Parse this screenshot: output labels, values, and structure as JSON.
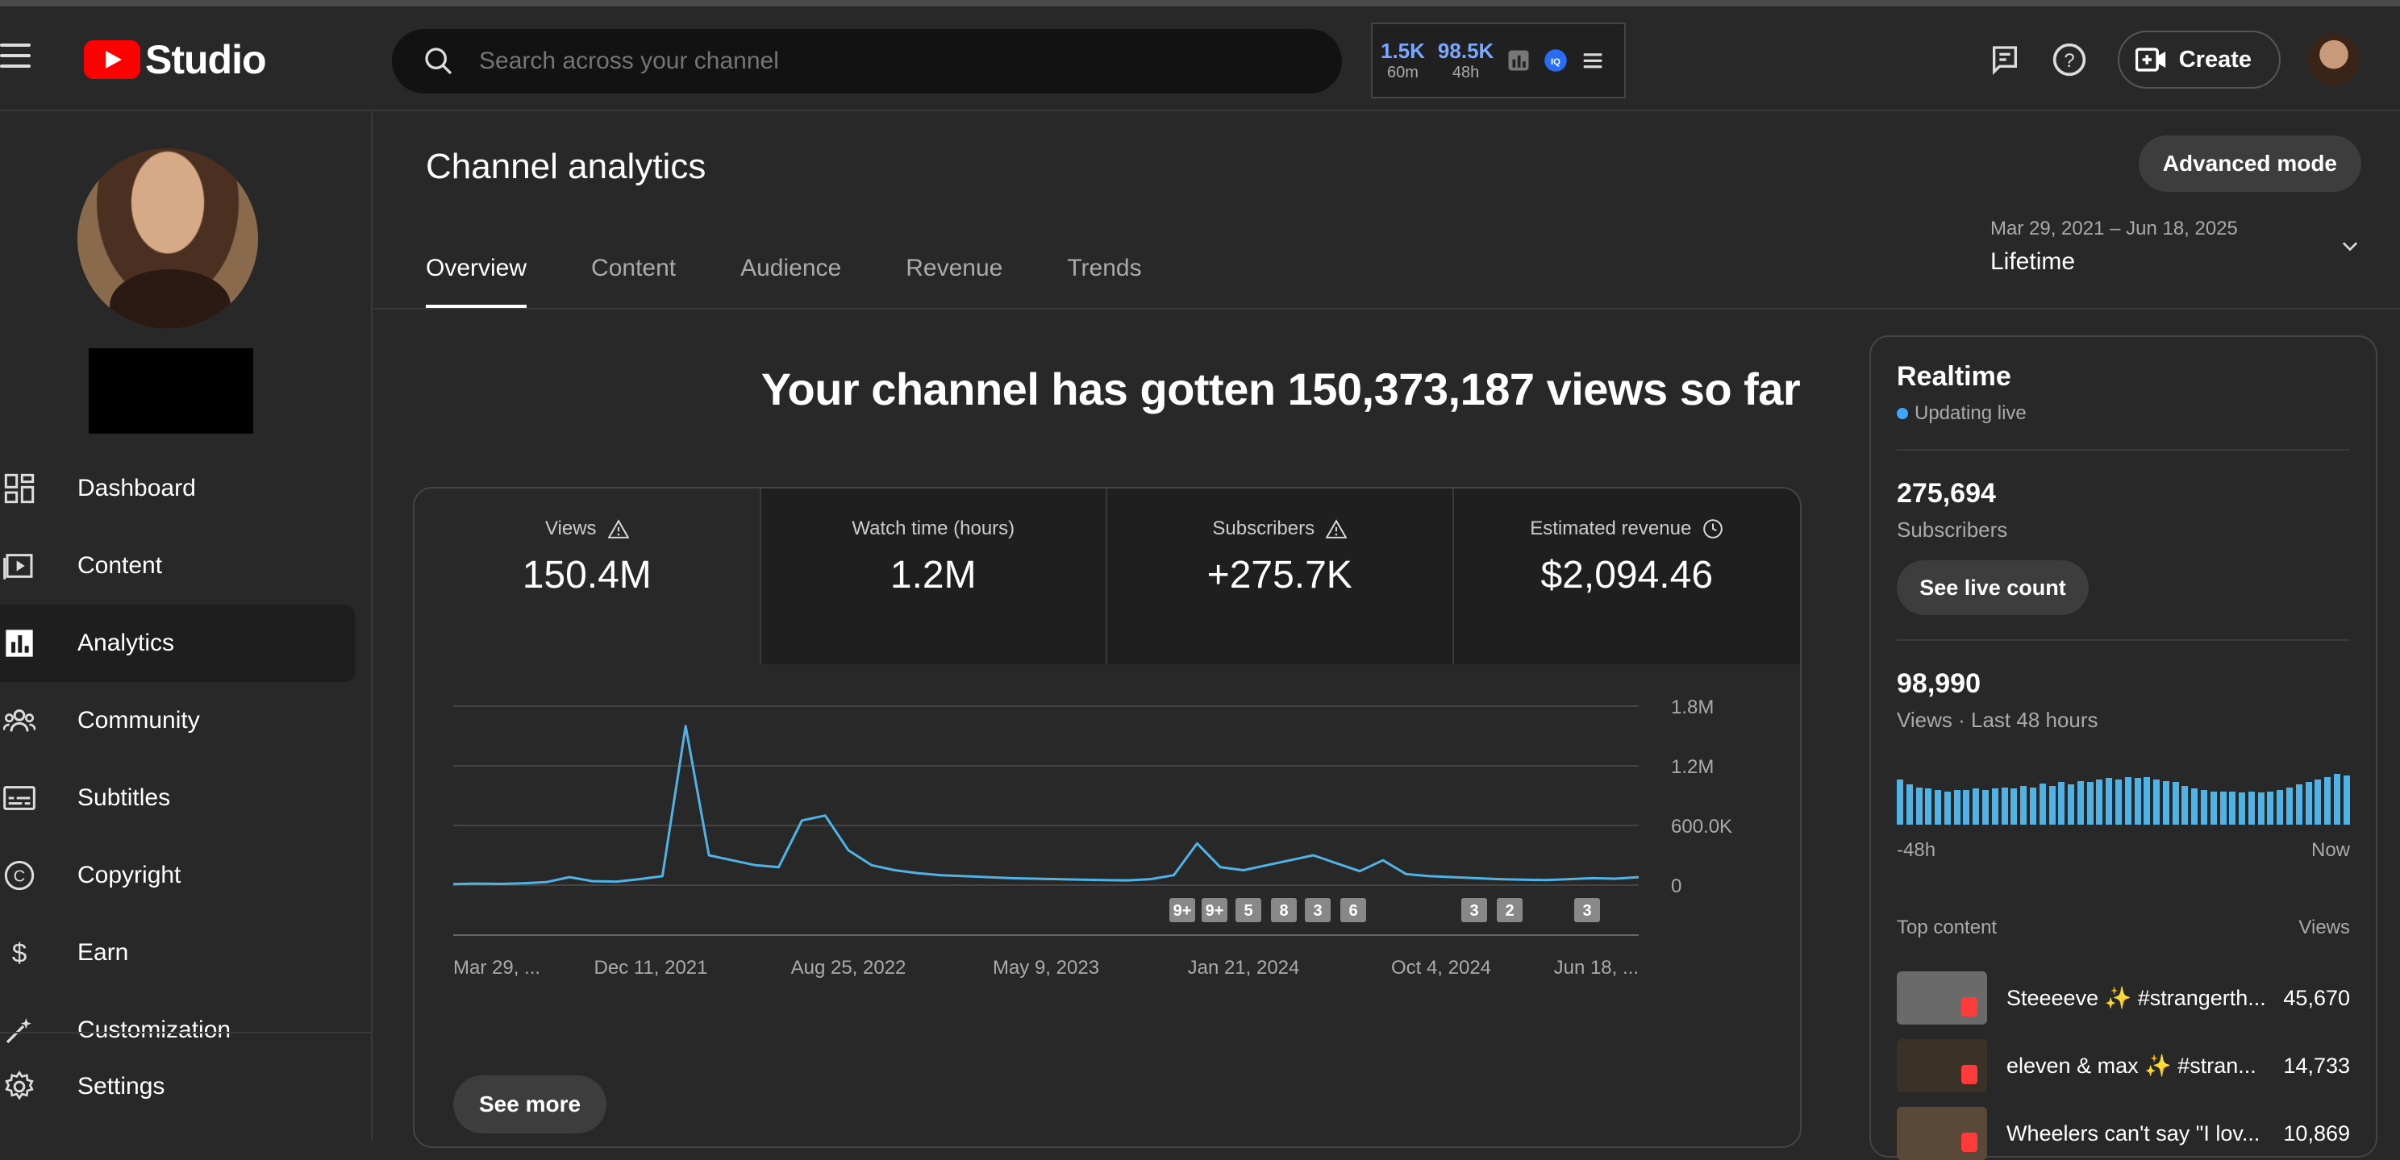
{
  "app": {
    "name": "Studio",
    "search_placeholder": "Search across your channel",
    "stats": [
      {
        "value": "1.5K",
        "period": "60m"
      },
      {
        "value": "98.5K",
        "period": "48h"
      }
    ],
    "create_label": "Create"
  },
  "sidebar": {
    "items": [
      {
        "label": "Dashboard",
        "icon": "dashboard-icon",
        "active": false
      },
      {
        "label": "Content",
        "icon": "content-icon",
        "active": false
      },
      {
        "label": "Analytics",
        "icon": "analytics-icon",
        "active": true
      },
      {
        "label": "Community",
        "icon": "community-icon",
        "active": false
      },
      {
        "label": "Subtitles",
        "icon": "subtitles-icon",
        "active": false
      },
      {
        "label": "Copyright",
        "icon": "copyright-icon",
        "active": false
      },
      {
        "label": "Earn",
        "icon": "earn-icon",
        "active": false
      },
      {
        "label": "Customization",
        "icon": "customization-icon",
        "active": false
      }
    ],
    "settings_label": "Settings"
  },
  "page": {
    "title": "Channel analytics",
    "advanced_mode": "Advanced mode",
    "tabs": [
      "Overview",
      "Content",
      "Audience",
      "Revenue",
      "Trends"
    ],
    "active_tab": "Overview",
    "date_range": "Mar 29, 2021 – Jun 18, 2025",
    "date_value": "Lifetime",
    "headline": "Your channel has gotten 150,373,187 views so far"
  },
  "kpis": [
    {
      "label": "Views",
      "value": "150.4M",
      "icon": "warning-icon"
    },
    {
      "label": "Watch time (hours)",
      "value": "1.2M",
      "icon": ""
    },
    {
      "label": "Subscribers",
      "value": "+275.7K",
      "icon": "warning-icon"
    },
    {
      "label": "Estimated revenue",
      "value": "$2,094.46",
      "icon": "clock-icon"
    }
  ],
  "see_more": "See more",
  "chart_data": {
    "type": "line",
    "series": [
      {
        "values": [
          10000,
          15000,
          12000,
          18000,
          30000,
          80000,
          40000,
          35000,
          60000,
          90000,
          1600000,
          300000,
          250000,
          200000,
          180000,
          650000,
          700000,
          350000,
          200000,
          150000,
          120000,
          100000,
          90000,
          80000,
          70000,
          65000,
          60000,
          55000,
          50000,
          48000,
          60000,
          100000,
          420000,
          180000,
          150000,
          200000,
          250000,
          300000,
          220000,
          140000,
          250000,
          110000,
          90000,
          80000,
          70000,
          60000,
          55000,
          50000,
          60000,
          70000,
          65000,
          80000
        ]
      }
    ],
    "x_tick_labels": [
      "Mar 29, ...",
      "Dec 11, 2021",
      "Aug 25, 2022",
      "May 9, 2023",
      "Jan 21, 2024",
      "Oct 4, 2024",
      "Jun 18, ..."
    ],
    "y_tick_labels": [
      "1.8M",
      "1.2M",
      "600.0K",
      "0"
    ],
    "ylim": [
      0,
      1800000
    ],
    "annotations": [
      "9+",
      "9+",
      "5",
      "8",
      "3",
      "6",
      "3",
      "2",
      "3"
    ],
    "series_color": "#4fb3e6",
    "grid": true
  },
  "realtime": {
    "title": "Realtime",
    "status": "Updating live",
    "subscribers": "275,694",
    "subscribers_label": "Subscribers",
    "see_live_count": "See live count",
    "views": "98,990",
    "views_label": "Views · Last 48 hours",
    "bar_values": [
      34,
      30,
      28,
      27,
      26,
      25,
      26,
      26,
      27,
      26,
      27,
      28,
      27,
      29,
      28,
      31,
      29,
      32,
      30,
      33,
      32,
      34,
      35,
      34,
      36,
      35,
      36,
      34,
      33,
      32,
      29,
      27,
      26,
      25,
      25,
      25,
      24,
      25,
      24,
      25,
      26,
      28,
      30,
      32,
      34,
      36,
      38,
      37
    ],
    "axis_start": "-48h",
    "axis_end": "Now",
    "top_content_label": "Top content",
    "views_col_label": "Views",
    "top_content": [
      {
        "title": "Steeeeve ✨ #strangerth...",
        "views": "45,670"
      },
      {
        "title": "eleven & max ✨ #stran...",
        "views": "14,733"
      },
      {
        "title": "Wheelers can't say \"I lov...",
        "views": "10,869"
      }
    ]
  }
}
